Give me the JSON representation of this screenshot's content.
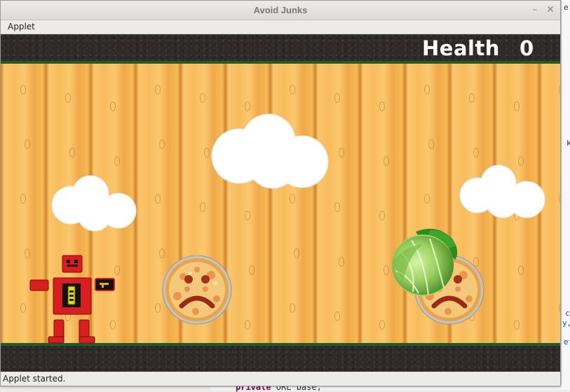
{
  "window": {
    "title": "Avoid Junks",
    "minimize_glyph": "–",
    "close_glyph": "✕"
  },
  "menubar": {
    "items": [
      {
        "label": "Applet"
      }
    ]
  },
  "hud": {
    "health_label": "Health",
    "health_value": "0"
  },
  "status": {
    "text": "Applet started."
  },
  "background_editor": {
    "fragments": [
      "e",
      "k",
      "c",
      "y,",
      "ef"
    ],
    "code_keyword": "private",
    "code_rest": " URL base;"
  },
  "sprites": {
    "player": "robot-player",
    "clouds": [
      "cloud",
      "cloud",
      "cloud"
    ],
    "junks": [
      "sad-pizza-junk",
      "sad-pizza-junk"
    ],
    "food": "cabbage-food"
  },
  "colors": {
    "floor": "#f7b955",
    "strip": "#2f2a28",
    "strip_border": "#1e5c2a",
    "hud_text": "#ffffff",
    "robot": "#d81e1e"
  }
}
